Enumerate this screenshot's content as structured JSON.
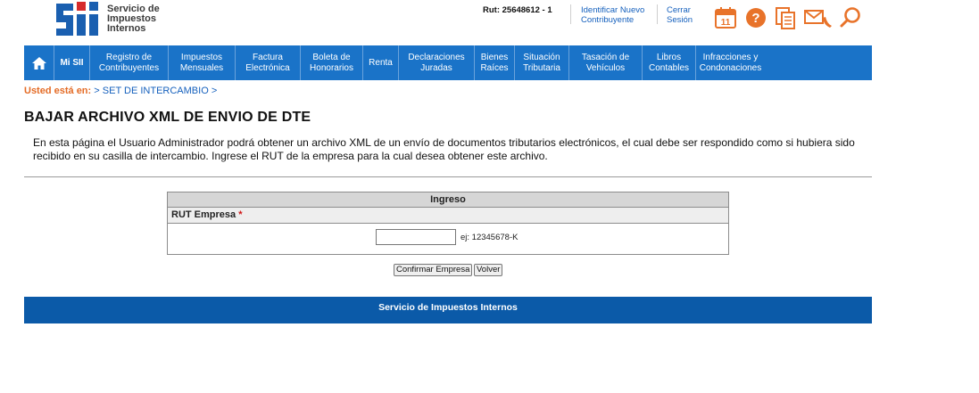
{
  "header": {
    "logo": {
      "brand": "SII",
      "line1": "Servicio de",
      "line2": "Impuestos",
      "line3": "Internos"
    },
    "rut": "Rut: 25648612 - 1",
    "link_identificar": {
      "line1": "Identificar Nuevo",
      "line2": "Contribuyente"
    },
    "link_cerrar": {
      "line1": "Cerrar",
      "line2": "Sesión"
    },
    "icons": [
      "calendar-icon",
      "help-icon",
      "documents-icon",
      "contact-icon",
      "search-icon"
    ],
    "calendar_day": "11"
  },
  "nav": {
    "items": [
      {
        "line1": "Mi SII",
        "line2": ""
      },
      {
        "line1": "Registro de",
        "line2": "Contribuyentes"
      },
      {
        "line1": "Impuestos",
        "line2": "Mensuales"
      },
      {
        "line1": "Factura",
        "line2": "Electrónica"
      },
      {
        "line1": "Boleta de",
        "line2": "Honorarios"
      },
      {
        "line1": "Renta",
        "line2": ""
      },
      {
        "line1": "Declaraciones",
        "line2": "Juradas"
      },
      {
        "line1": "Bienes",
        "line2": "Raíces"
      },
      {
        "line1": "Situación",
        "line2": "Tributaria"
      },
      {
        "line1": "Tasación de",
        "line2": "Vehículos"
      },
      {
        "line1": "Libros",
        "line2": "Contables"
      },
      {
        "line1": "Infracciones y",
        "line2": "Condonaciones"
      }
    ]
  },
  "breadcrumb": {
    "label": "Usted está en:",
    "items": [
      "SET DE INTERCAMBIO"
    ]
  },
  "page": {
    "title": "BAJAR ARCHIVO XML DE ENVIO DE DTE",
    "description": "En esta página el Usuario Administrador podrá obtener un archivo XML de un envío de documentos tributarios electrónicos, el cual debe ser respondido como si hubiera sido recibido en su casilla de intercambio. Ingrese el RUT de la empresa para la cual desea obtener este archivo."
  },
  "form": {
    "header": "Ingreso",
    "field_label": "RUT Empresa",
    "required_mark": "*",
    "rut_value": "",
    "hint": "ej: 12345678-K",
    "confirm_label": "Confirmar Empresa",
    "back_label": "Volver"
  },
  "footer": {
    "text": "Servicio de Impuestos Internos"
  },
  "colors": {
    "nav_blue": "#1a73c8",
    "footer_blue": "#0b5aa8",
    "accent_orange": "#e46b25",
    "link_blue": "#1560bd"
  }
}
